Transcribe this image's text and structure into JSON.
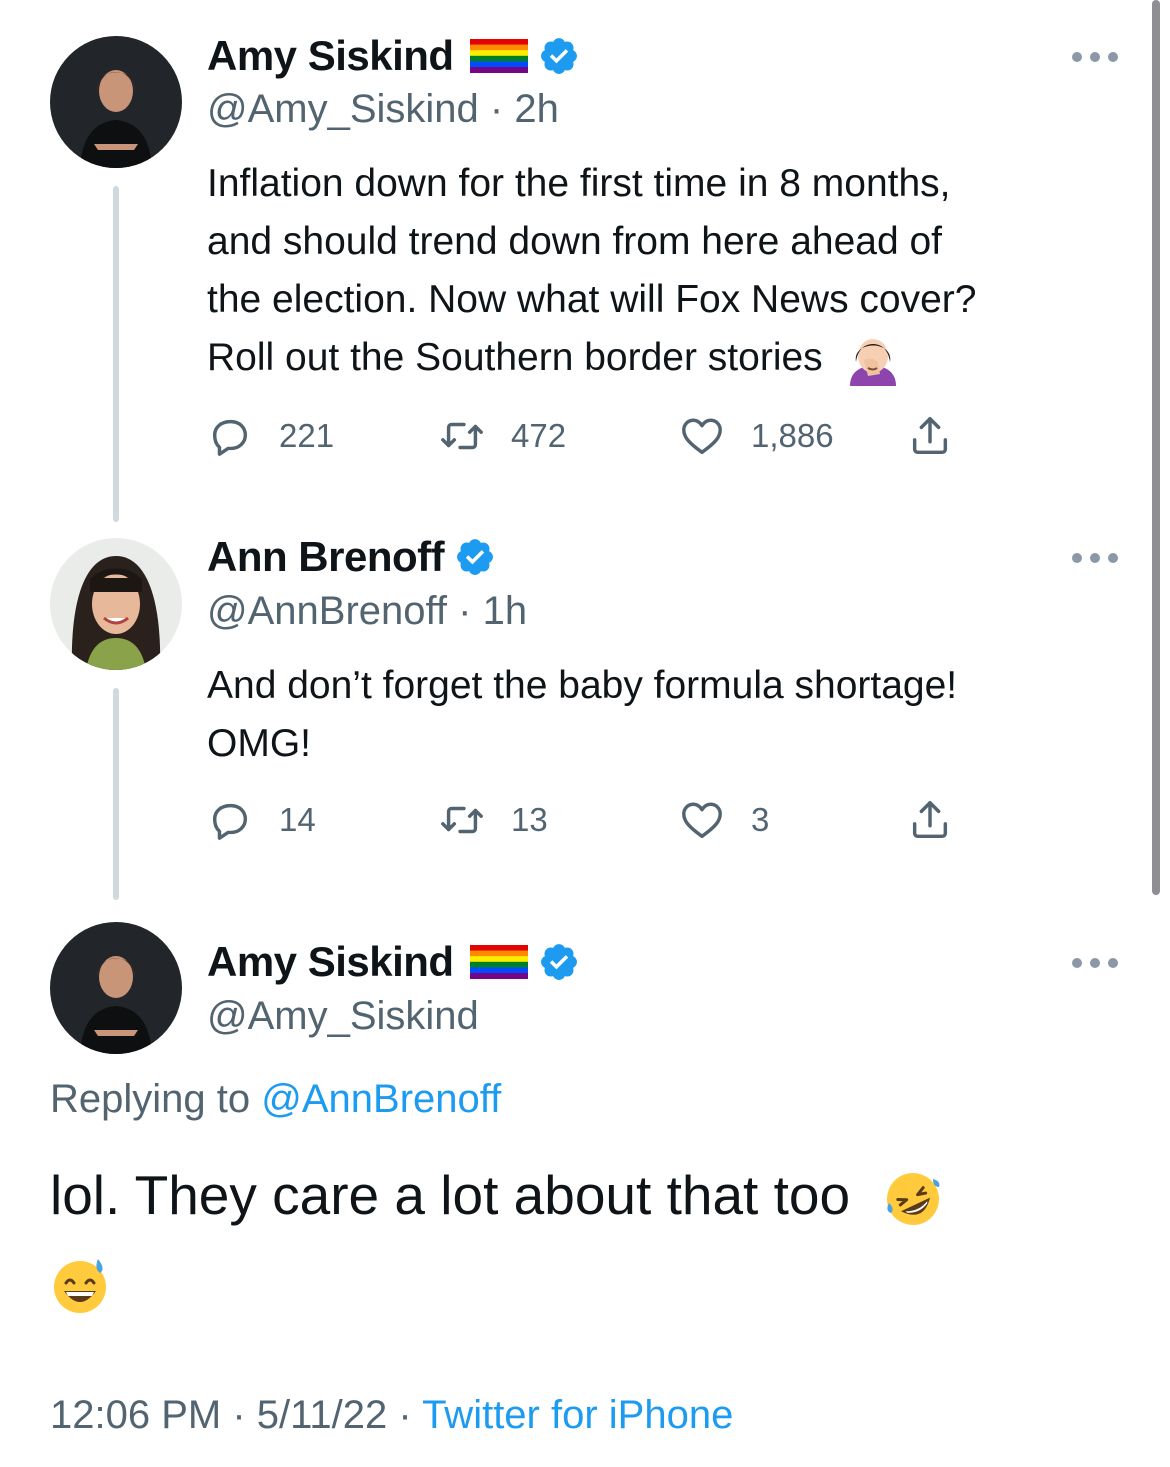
{
  "tweets": [
    {
      "name": "Amy Siskind",
      "handle_time": "@Amy_Siskind · 2h",
      "text_lines": [
        "Inflation down for the first time in 8 months,",
        "and should trend down from here ahead of",
        "the election. Now what will Fox News cover?",
        "Roll out the Southern border stories"
      ],
      "reply_count": "221",
      "retweet_count": "472",
      "like_count": "1,886"
    },
    {
      "name": "Ann Brenoff",
      "handle_time": "@AnnBrenoff · 1h",
      "text_lines": [
        "And don’t forget the baby formula shortage!",
        "OMG!"
      ],
      "reply_count": "14",
      "retweet_count": "13",
      "like_count": "3"
    }
  ],
  "main_tweet": {
    "name": "Amy Siskind",
    "handle": "@Amy_Siskind",
    "replying_prefix": "Replying to",
    "replying_to": "@AnnBrenoff",
    "text": "lol. They care a lot about that too",
    "timestamp": "12:06 PM · 5/11/22 · ",
    "source": "Twitter for iPhone"
  },
  "icons": {
    "flag": "rainbow-flag-icon",
    "verified": "verified-badge-icon",
    "more": "more-options-icon",
    "reply": "reply-icon",
    "retweet": "retweet-icon",
    "like": "like-icon",
    "share": "share-icon"
  },
  "colors": {
    "accent": "#1d9bf0",
    "secondary_text": "#536471",
    "thread_line": "#cfd9de"
  }
}
